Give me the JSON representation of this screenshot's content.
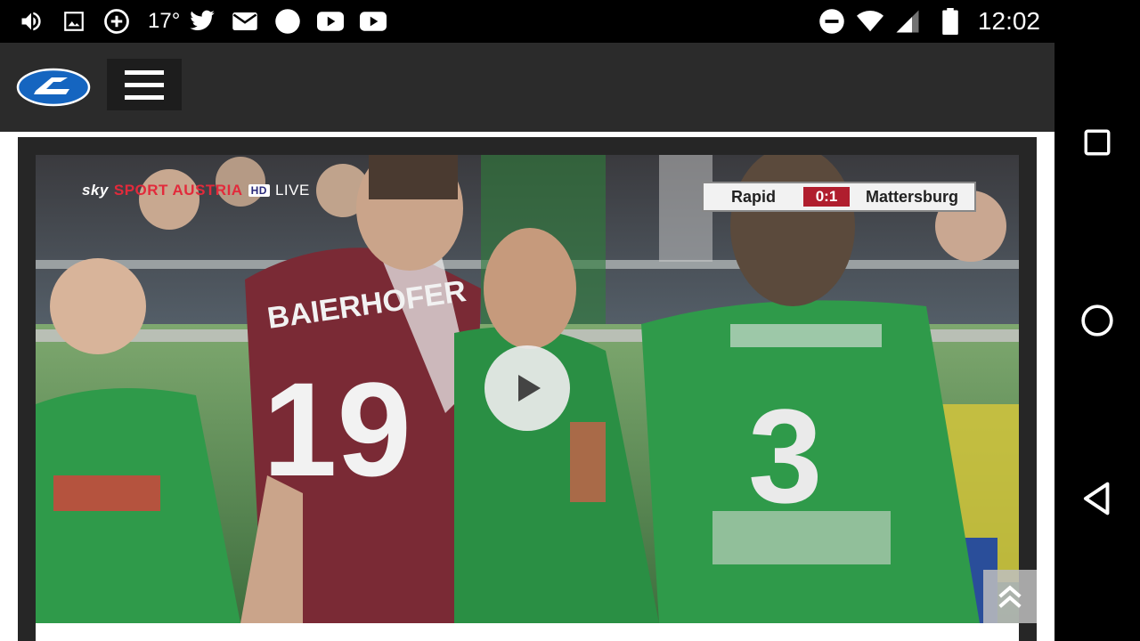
{
  "status_bar": {
    "temperature": "17°",
    "time": "12:02",
    "left_icons": [
      "volume-icon",
      "image-icon",
      "add-circle-icon",
      "twitter-icon",
      "mail-icon",
      "circle-icon",
      "youtube-icon",
      "youtube-icon"
    ],
    "right_icons": [
      "do-not-disturb-icon",
      "wifi-icon",
      "signal-icon",
      "battery-icon"
    ]
  },
  "header": {
    "logo_name": "laola1-logo-icon",
    "menu_name": "hamburger-menu-icon"
  },
  "video": {
    "broadcaster": {
      "sky": "sky",
      "sport": "SPORT AUSTRIA",
      "hd": "HD",
      "live": "LIVE"
    },
    "scoreboard": {
      "home": "Rapid",
      "score": "0:1",
      "away": "Mattersburg"
    },
    "jersey_left_name": "BAIERHOFER",
    "jersey_left_number": "19",
    "jersey_right_number": "3"
  },
  "nav_bar": {
    "buttons": [
      "recents-button",
      "home-button",
      "back-button"
    ]
  },
  "colors": {
    "header_bg": "#2b2b2b",
    "logo_blue": "#1565c0",
    "score_red": "#b01e2e",
    "jersey_green": "#2f9a4a",
    "jersey_maroon": "#7a2a35"
  }
}
